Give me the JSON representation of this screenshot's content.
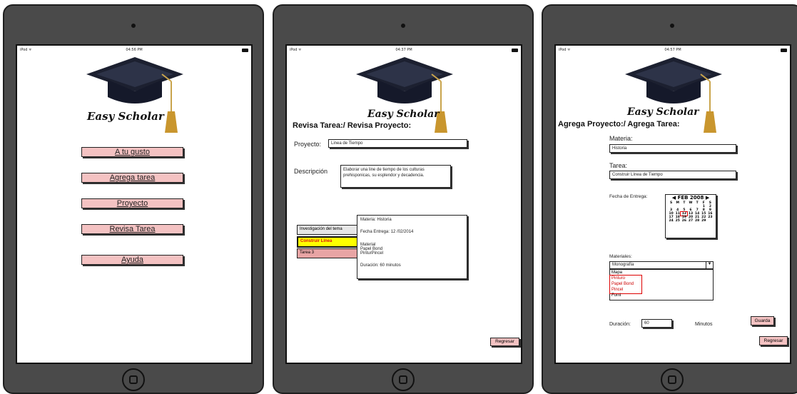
{
  "device": {
    "carrier": "iPod ᯤ"
  },
  "app": {
    "name": "Easy Scholar"
  },
  "screen1": {
    "time": "04:56 PM",
    "menu": [
      "A tu gusto",
      "Agrega tarea",
      "Proyecto",
      "Revisa Tarea",
      "Ayuda"
    ]
  },
  "screen2": {
    "time": "04:37 PM",
    "heading": "Revisa Tarea:/ Revisa Proyecto:",
    "proyecto_label": "Proyecto:",
    "proyecto_value": "Linea de Tiempo",
    "descripcion_label": "Descripción",
    "descripcion_value": "Elaborar una line de tiempo de los culturas prehisponicas, su esplendor y decadencia.",
    "tasks": [
      "Investigación del tema",
      "Construir Línea",
      "Tarea 3"
    ],
    "detail": {
      "materia": "Materia: Historia",
      "fecha": "Fecha Entrega: 12 /02/2014",
      "material_title": "Material",
      "materials": [
        "Papel Bond",
        "PinturPincel"
      ],
      "duracion": "Duración: 60 minutos"
    },
    "back_button": "Regresar"
  },
  "screen3": {
    "time": "04:57 PM",
    "heading": "Agrega Proyecto:/ Agrega Tarea:",
    "materia_label": "Materia:",
    "materia_value": "Historia",
    "tarea_label": "Tarea:",
    "tarea_value": "Construir Línea de Tiempo",
    "fecha_label": "Fecha de Entrega:",
    "calendar": {
      "header": "◀ FEB 2008 ▶",
      "weekdays": [
        "S",
        "M",
        "T",
        "W",
        "T",
        "F",
        "S"
      ],
      "days": [
        "",
        "",
        "",
        "",
        "",
        "1",
        "2",
        "3",
        "4",
        "5",
        "6",
        "7",
        "8",
        "9",
        "10",
        "11",
        "12",
        "13",
        "14",
        "15",
        "16",
        "17",
        "18",
        "19",
        "20",
        "21",
        "22",
        "23",
        "24",
        "25",
        "26",
        "27",
        "28",
        "29",
        ""
      ],
      "selected": "12"
    },
    "materiales_label": "Materiales:",
    "materiales_selected": "Monografía",
    "materiales_options": [
      "Mapa",
      "Pinturo",
      "Papel Bond",
      "Pincel",
      "Fomi"
    ],
    "duracion_label": "Duración:",
    "duracion_value": "60",
    "minutos_label": "Minutos",
    "save_button": "Guarda",
    "back_button": "Regresar"
  }
}
